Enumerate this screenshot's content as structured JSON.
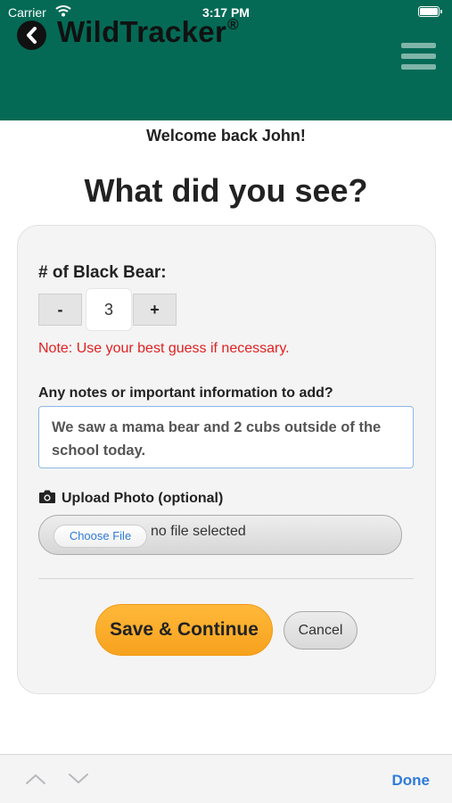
{
  "status_bar": {
    "carrier": "Carrier",
    "time": "3:17 PM",
    "icons": [
      "wifi-icon",
      "battery-icon"
    ]
  },
  "header": {
    "brand": "WildTracker",
    "trademark": "®",
    "icons": [
      "back-arrow-icon",
      "hamburger-menu-icon"
    ],
    "colors": {
      "background": "#046a55",
      "menu_icon": "#7fb5a9"
    }
  },
  "welcome_text": "Welcome back John!",
  "page_title": "What did you see?",
  "form": {
    "count_label": "# of Black Bear:",
    "decrement_label": "-",
    "quantity": "3",
    "increment_label": "+",
    "note": "Note: Use your best guess if necessary.",
    "notes_label": "Any notes or important information to add?",
    "notes_value": "We saw a mama bear and 2 cubs outside of the school today.",
    "upload_label": "Upload Photo (optional)",
    "upload_icon": "camera-icon",
    "choose_file_label": "Choose File",
    "no_file_text": "no file selected",
    "save_label": "Save & Continue",
    "cancel_label": "Cancel",
    "colors": {
      "note": "#e02020",
      "save_button": "#f7a21e",
      "focus_border": "#8fb8e6"
    }
  },
  "keyboard_bar": {
    "done_label": "Done",
    "icons": [
      "chevron-up-icon",
      "chevron-down-icon"
    ],
    "colors": {
      "done": "#2f7bd8"
    }
  }
}
